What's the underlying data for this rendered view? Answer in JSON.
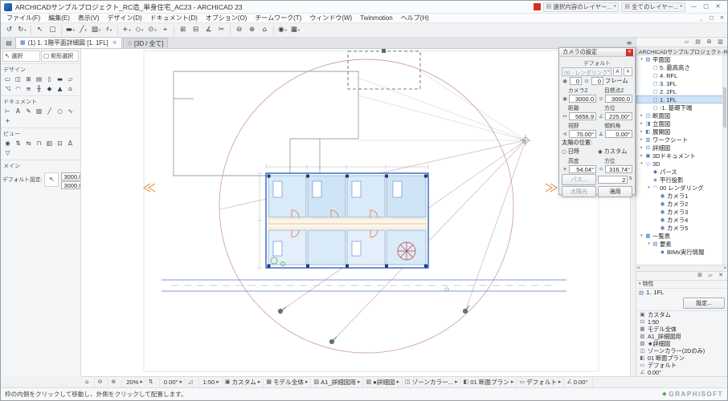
{
  "titlebar": {
    "title": "ARCHICADサンプルプロジェクト_RC造_単身住宅_AC23 - ARCHICAD 23",
    "layers_icon": "▤",
    "layer_group1": "選択内容のレイヤー...",
    "layer_group2": "全てのレイヤー...",
    "caret": "▾",
    "minimize_glyph": "—",
    "maximize_glyph": "□",
    "close_glyph": "✕"
  },
  "menubar": {
    "items": [
      "ファイル(F)",
      "編集(E)",
      "表示(V)",
      "デザイン(D)",
      "ドキュメント(D)",
      "オプション(O)",
      "チームワーク(T)",
      "ウィンドウ(W)",
      "Twinmotion",
      "ヘルプ(H)"
    ],
    "doc_minimize_glyph": "_",
    "doc_restore_glyph": "▢",
    "doc_close_glyph": "✕"
  },
  "toolbar": {
    "icons": [
      {
        "n": "undo-icon",
        "g": "↺"
      },
      {
        "n": "redo-icon",
        "g": "↻",
        "dd": true
      },
      {
        "n": "toolbar-separator",
        "sep": true
      },
      {
        "n": "arrow-tool-icon",
        "g": "↖"
      },
      {
        "n": "marquee-tool-icon",
        "g": "▢"
      },
      {
        "n": "toolbar-separator",
        "sep": true
      },
      {
        "n": "favorite-wall-icon",
        "g": "▬",
        "dd": true
      },
      {
        "n": "favorite-line-icon",
        "g": "╱",
        "dd": true
      },
      {
        "n": "favorite-fill-icon",
        "g": "▨",
        "dd": true
      },
      {
        "n": "grid-snap-icon",
        "g": "♯",
        "dd": true
      },
      {
        "n": "toolbar-separator",
        "sep": true
      },
      {
        "n": "guide-lines-icon",
        "g": "+",
        "dd": true
      },
      {
        "n": "snap-points-icon",
        "g": "◇",
        "dd": true
      },
      {
        "n": "gravity-icon",
        "g": "⊙",
        "dd": true
      },
      {
        "n": "coordinate-icon",
        "g": "⌖"
      },
      {
        "n": "toolbar-separator",
        "sep": true
      },
      {
        "n": "group-icon",
        "g": "⊞"
      },
      {
        "n": "suspend-group-icon",
        "g": "⊟"
      },
      {
        "n": "measure-icon",
        "g": "∡"
      },
      {
        "n": "cut-icon",
        "g": "✂"
      },
      {
        "n": "toolbar-separator",
        "sep": true
      },
      {
        "n": "zoom-out-icon",
        "g": "⊖"
      },
      {
        "n": "zoom-in-icon",
        "g": "⊕"
      },
      {
        "n": "fit-in-window-icon",
        "g": "⌂"
      },
      {
        "n": "toolbar-separator",
        "sep": true
      },
      {
        "n": "camera-view-icon",
        "g": "◉",
        "dd": true
      },
      {
        "n": "show-3d-icon",
        "g": "▦",
        "dd": true
      }
    ]
  },
  "tabs_bar": {
    "view_menu_glyph": "▤",
    "plan_icon": "▦",
    "cube_icon": "◇",
    "overflow_glyph": "≡",
    "tabs": [
      {
        "label": "(1) 1. 1階平面詳細図 [1. 1FL]",
        "close": "×"
      },
      {
        "label": "[3D / 全て]"
      }
    ]
  },
  "toolbox": {
    "select_icon": "↖",
    "select_label": "選択",
    "marquee_icon": "▢",
    "marquee_label": "矩形選択",
    "design_title": "デザイン",
    "design_tools": [
      {
        "n": "wall-tool-icon",
        "g": "▭"
      },
      {
        "n": "door-tool-icon",
        "g": "◫"
      },
      {
        "n": "window-tool-icon",
        "g": "⊞"
      },
      {
        "n": "curtain-wall-tool-icon",
        "g": "▤"
      },
      {
        "n": "column-tool-icon",
        "g": "▯"
      },
      {
        "n": "beam-tool-icon",
        "g": "▬"
      },
      {
        "n": "slab-tool-icon",
        "g": "▱"
      },
      {
        "n": "roof-tool-icon",
        "g": "◹"
      },
      {
        "n": "shell-tool-icon",
        "g": "◠"
      },
      {
        "n": "stair-tool-icon",
        "g": "≡"
      },
      {
        "n": "railing-tool-icon",
        "g": "╫"
      },
      {
        "n": "morph-tool-icon",
        "g": "◆"
      },
      {
        "n": "mesh-tool-icon",
        "g": "▲"
      },
      {
        "n": "zone-tool-icon",
        "g": "⌂"
      }
    ],
    "document_title": "ドキュメント",
    "document_tools": [
      {
        "n": "dimension-tool-icon",
        "g": "⊢"
      },
      {
        "n": "text-tool-icon",
        "g": "A"
      },
      {
        "n": "label-tool-icon",
        "g": "✎"
      },
      {
        "n": "fill-tool-icon",
        "g": "▨"
      },
      {
        "n": "line-tool-icon",
        "g": "╱"
      },
      {
        "n": "circle-tool-icon",
        "g": "○"
      },
      {
        "n": "spline-tool-icon",
        "g": "∿"
      },
      {
        "n": "hotspot-tool-icon",
        "g": "+"
      }
    ],
    "view_title": "ビュー",
    "view_tools": [
      {
        "n": "camera-tool-icon",
        "g": "◉"
      },
      {
        "n": "section-tool-icon",
        "g": "⇅"
      },
      {
        "n": "elevation-tool-icon",
        "g": "⇆"
      },
      {
        "n": "interior-elevation-tool-icon",
        "g": "⊓"
      },
      {
        "n": "worksheet-tool-icon",
        "g": "▥"
      },
      {
        "n": "detail-tool-icon",
        "g": "⊡"
      },
      {
        "n": "change-tool-icon",
        "g": "Δ"
      },
      {
        "n": "marker-tool-icon",
        "g": "▽"
      }
    ],
    "main_title": "メイン",
    "default_label": "デフォルト設定:",
    "default_btn_icon": "↖",
    "fields": [
      "3000.0",
      "3000.0"
    ]
  },
  "palette": {
    "title": "カメラの設定",
    "close_glyph": "✕",
    "default_label": "デフォルト",
    "path_dropdown": "00 - レンダリング",
    "caret_glyph": "▾",
    "az_glyph": "A",
    "del_glyph": "✕",
    "cam_glyph": "◉",
    "target_glyph": "⊙",
    "frame_values": [
      "0",
      "0"
    ],
    "frame_label": "フレーム",
    "camera_z_label": "カメラZ",
    "camera_z": "3000.0",
    "target_z_label": "目標点Z",
    "target_z": "3000.0",
    "distance_label": "距離",
    "distance": "5656.9",
    "azimuth_label": "方位",
    "azimuth": "225.00°",
    "fov_label": "視野",
    "fov": "70.00°",
    "tilt_label": "傾斜角",
    "tilt": "0.00°",
    "sun_section_label": "太陽の位置:",
    "radio_unselected_glyph": "○",
    "radio_selected_glyph": "◉",
    "datetime_label": "日時",
    "custom_label": "カスタム",
    "altitude_label": "高度",
    "altitude": "54.04°",
    "sun_azimuth_label": "方位",
    "sun_azimuth": "316.74°",
    "path_button": "パス...",
    "step_value": "2",
    "spin_glyph": "⇅",
    "sun_button": "太陽光",
    "apply_button": "適用",
    "dist_icon": "↔",
    "ang_icon": "∠",
    "fov_icon": "⊲",
    "tilt_icon": "∡",
    "alt_icon": "☀",
    "sunaz_icon": "☼"
  },
  "navigator": {
    "top_icons": [
      {
        "n": "pin-palette-icon",
        "g": "▱"
      },
      {
        "n": "navigator-icon",
        "g": "▤"
      },
      {
        "n": "organizer-icon",
        "g": "⊞"
      },
      {
        "n": "help-panel-icon",
        "g": "▥"
      }
    ],
    "title": "ARCHICADサンプルプロジェクト-RC...",
    "collapse_glyph": "^",
    "hscroll_left": "◂",
    "hscroll_right": "▸",
    "tree": [
      {
        "e": "▾",
        "i": "▤",
        "l": "平面図",
        "d": 0
      },
      {
        "i": "▢",
        "l": "5. 最高高さ",
        "d": 1
      },
      {
        "i": "▢",
        "l": "4. RFL",
        "d": 1
      },
      {
        "i": "▢",
        "l": "3. 3FL",
        "d": 1
      },
      {
        "i": "▢",
        "l": "2. 2FL",
        "d": 1
      },
      {
        "i": "▢",
        "l": "1. 1FL",
        "d": 1,
        "sel": true
      },
      {
        "i": "▢",
        "l": "-1. 基礎下端",
        "d": 1
      },
      {
        "e": "▸",
        "i": "◫",
        "l": "断面図",
        "d": 0
      },
      {
        "e": "▸",
        "i": "◨",
        "l": "立面図",
        "d": 0
      },
      {
        "e": "▸",
        "i": "◧",
        "l": "展開図",
        "d": 0
      },
      {
        "e": "▸",
        "i": "▥",
        "l": "ワークシート",
        "d": 0
      },
      {
        "e": "▸",
        "i": "⊡",
        "l": "詳細図",
        "d": 0
      },
      {
        "e": "▸",
        "i": "▣",
        "l": "3Dドキュメント",
        "d": 0
      },
      {
        "e": "▾",
        "i": "◇",
        "l": "3D",
        "d": 0
      },
      {
        "i": "◆",
        "l": "パース",
        "d": 1
      },
      {
        "i": "◈",
        "l": "平行投影",
        "d": 1
      },
      {
        "e": "▾",
        "i": "◠",
        "l": "00 レンダリング",
        "d": 1
      },
      {
        "i": "◉",
        "l": "カメラ1",
        "d": 2
      },
      {
        "i": "◉",
        "l": "カメラ2",
        "d": 2
      },
      {
        "i": "◉",
        "l": "カメラ3",
        "d": 2
      },
      {
        "i": "◉",
        "l": "カメラ4",
        "d": 2
      },
      {
        "i": "◉",
        "l": "カメラ5",
        "d": 2
      },
      {
        "e": "▾",
        "i": "▦",
        "l": "一覧表",
        "d": 0
      },
      {
        "e": "▾",
        "i": "▤",
        "l": "要素",
        "d": 1
      },
      {
        "i": "▪",
        "l": "BIMx実行情報",
        "d": 2
      }
    ],
    "footer_icons": [
      {
        "n": "view-settings-icon",
        "g": "⊞"
      },
      {
        "n": "clone-folder-icon",
        "g": "▱"
      },
      {
        "n": "delete-icon",
        "g": "✕"
      }
    ],
    "properties_caret": "▾",
    "properties_header": "特性",
    "story_icon": "▤",
    "story_no": "1.",
    "story_name": "1FL",
    "settings_button": "設定...",
    "props": [
      {
        "n": "layer-combination",
        "i": "▣",
        "l": "カスタム"
      },
      {
        "n": "drawing-scale",
        "i": "⊡",
        "l": "1:50"
      },
      {
        "n": "structure-display",
        "i": "▦",
        "l": "モデル全体"
      },
      {
        "n": "pen-set",
        "i": "▧",
        "l": "A1_詳細図用"
      },
      {
        "n": "model-view-options",
        "i": "▨",
        "l": "★詳細図"
      },
      {
        "n": "graphic-override",
        "i": "◫",
        "l": "ゾーンカラー(2Dのみ)"
      },
      {
        "n": "renovation-filter",
        "i": "◧",
        "l": "01 断面プラン"
      },
      {
        "n": "dimension-style",
        "i": "▭",
        "l": "デフォルト"
      },
      {
        "n": "orientation",
        "i": "∠",
        "l": "0.00°"
      }
    ]
  },
  "bottombar": {
    "items": [
      {
        "n": "fit-in-window-icon",
        "icon": "⌂"
      },
      {
        "n": "zoom-out-icon",
        "icon": "⊖"
      },
      {
        "n": "zoom-in-icon",
        "icon": "⊕"
      },
      {
        "n": "zoom-level",
        "text": "20%",
        "caret": "▸"
      },
      {
        "n": "orientation-icon",
        "icon": "⇅"
      },
      {
        "n": "rotation-angle",
        "text": "0.00°",
        "caret": "▸"
      },
      {
        "n": "scale-icon",
        "icon": "◿"
      },
      {
        "n": "drawing-scale",
        "text": "1:50",
        "caret": "▸"
      },
      {
        "n": "layer-combination",
        "icon": "▣",
        "text": "カスタム",
        "caret": "▸"
      },
      {
        "n": "structure-display",
        "icon": "▦",
        "text": "モデル全体",
        "caret": "▸"
      },
      {
        "n": "pen-set",
        "icon": "▧",
        "text": "A1_詳細図用",
        "caret": "▸"
      },
      {
        "n": "model-view-options",
        "icon": "▨",
        "text": "●詳細図",
        "caret": "▸"
      },
      {
        "n": "graphic-override",
        "icon": "◫",
        "text": "ゾーンカラー...",
        "caret": "▸"
      },
      {
        "n": "renovation-filter",
        "icon": "◧",
        "text": "01 断面プラン",
        "caret": "▸"
      },
      {
        "n": "dimension-style",
        "icon": "▭",
        "text": "デフォルト",
        "caret": "▸"
      },
      {
        "n": "orientation-angle",
        "icon": "∠",
        "text": "0.00°"
      }
    ]
  },
  "statusbar": {
    "hint": "枠の内側をクリックして移動し、外側をクリックして配置します。",
    "brand_icon": "◆",
    "brand": "GRAPHISOFT"
  }
}
